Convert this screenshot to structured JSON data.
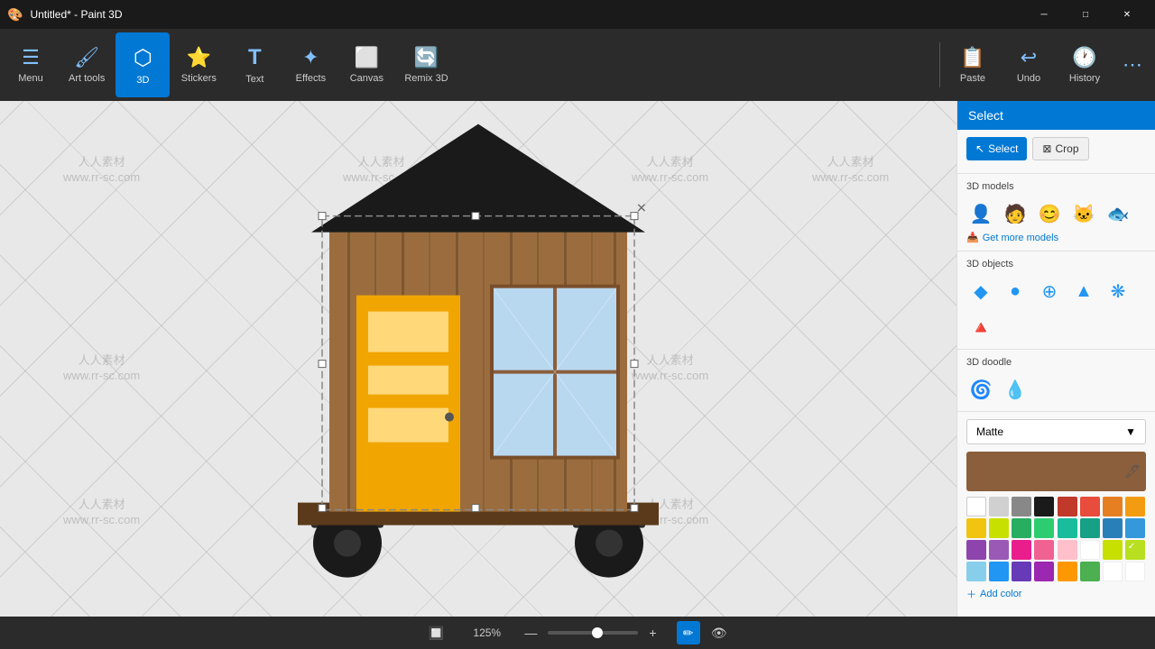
{
  "window": {
    "title": "Untitled* - Paint 3D",
    "controls": {
      "minimize": "─",
      "maximize": "□",
      "close": "✕"
    }
  },
  "toolbar": {
    "items": [
      {
        "id": "menu",
        "label": "Menu",
        "icon": "☰"
      },
      {
        "id": "art-tools",
        "label": "Art tools",
        "icon": "🖌"
      },
      {
        "id": "3d",
        "label": "3D",
        "icon": "◈",
        "active": true
      },
      {
        "id": "stickers",
        "label": "Stickers",
        "icon": "⭐"
      },
      {
        "id": "text",
        "label": "Text",
        "icon": "T"
      },
      {
        "id": "effects",
        "label": "Effects",
        "icon": "✦"
      },
      {
        "id": "canvas",
        "label": "Canvas",
        "icon": "⬜"
      },
      {
        "id": "remix3d",
        "label": "Remix 3D",
        "icon": "🔄"
      }
    ],
    "right_items": [
      {
        "id": "paste",
        "label": "Paste",
        "icon": "📋"
      },
      {
        "id": "undo",
        "label": "Undo",
        "icon": "↩"
      },
      {
        "id": "history",
        "label": "History",
        "icon": "🕐"
      },
      {
        "id": "more",
        "label": "...",
        "icon": "⋯"
      }
    ]
  },
  "panel": {
    "title": "Select",
    "select_btn": "Select",
    "crop_btn": "Crop",
    "sections": {
      "models": {
        "title": "3D models",
        "icons": [
          "👤",
          "👤",
          "🎭",
          "🐱",
          "🐟"
        ],
        "get_more": "Get more models"
      },
      "objects": {
        "title": "3D objects",
        "icons": [
          "◆",
          "●",
          "▲",
          "▼",
          "❋"
        ]
      },
      "doodle": {
        "title": "3D doodle",
        "icons": [
          "🌀",
          "💧"
        ]
      }
    },
    "matte_label": "Matte",
    "current_color": "#8B5E3C",
    "palette": [
      "#ffffff",
      "#d0d0d0",
      "#888888",
      "#1a1a1a",
      "#c0392b",
      "#e74c3c",
      "#e67e22",
      "#f39c12",
      "#f1c40f",
      "#c8e000",
      "#27ae60",
      "#2ecc71",
      "#1abc9c",
      "#16a085",
      "#2980b9",
      "#3498db",
      "#8e44ad",
      "#9b59b6",
      "#e91e8c",
      "#f06292",
      "#ffc0cb",
      "#ffffff",
      "#87ceeb",
      "#2196f3",
      "#673ab7",
      "#9c27b0",
      "#ff9800",
      "#4caf50"
    ],
    "add_color": "Add color"
  },
  "bottombar": {
    "zoom_percent": "125%",
    "zoom_minus": "—",
    "zoom_plus": "+"
  }
}
